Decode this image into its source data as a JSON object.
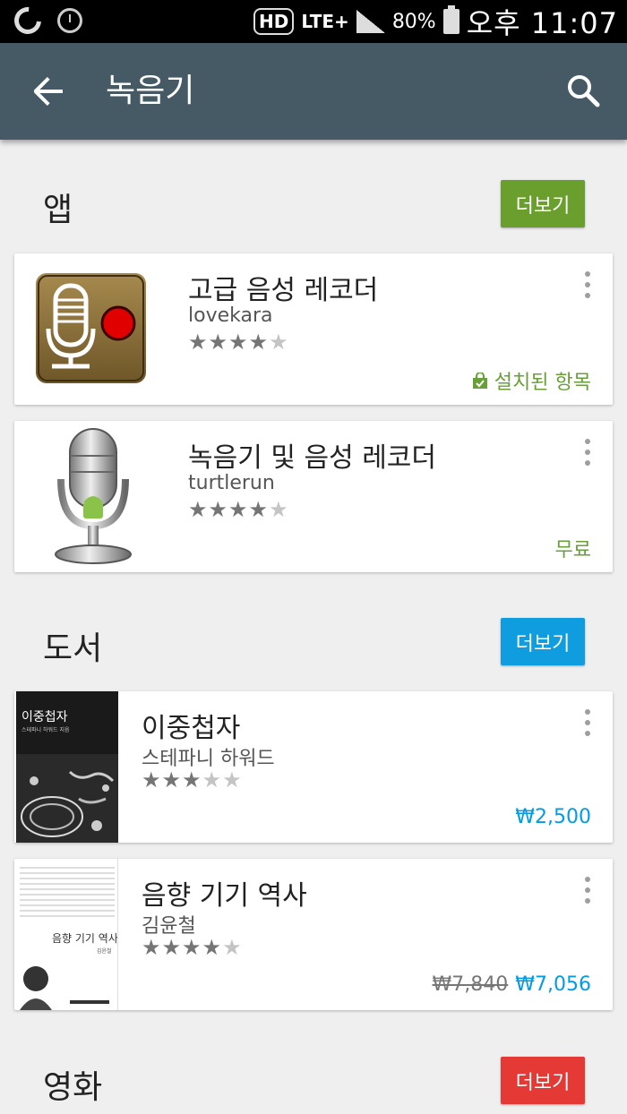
{
  "status_bar": {
    "hd": "HD",
    "lte": "LTE+",
    "battery": "80%",
    "time": "오후 11:07"
  },
  "toolbar": {
    "title": "녹음기"
  },
  "sections": [
    {
      "title": "앱",
      "more_label": "더보기",
      "more_color": "#6a9f2e",
      "items": [
        {
          "title": "고급 음성 레코더",
          "author": "lovekara",
          "rating": 4.5,
          "status": "설치된 항목",
          "icon": "voice-recorder-icon"
        },
        {
          "title": "녹음기 및 음성 레코더",
          "author": "turtlerun",
          "rating": 4.5,
          "price": "무료",
          "icon": "android-mic-icon"
        }
      ]
    },
    {
      "title": "도서",
      "more_label": "더보기",
      "more_color": "#0f9de0",
      "items": [
        {
          "title": "이중첩자",
          "author": "스테파니 하워드",
          "rating": 3.5,
          "price": "₩2,500",
          "cover_title": "이중첩자",
          "cover_subtitle": "스테파니 하워드 지음"
        },
        {
          "title": "음향 기기 역사",
          "author": "김윤철",
          "rating": 4.5,
          "original_price": "₩7,840",
          "price": "₩7,056",
          "cover_title": "음향 기기 역사",
          "cover_author": "김윤철"
        }
      ]
    },
    {
      "title": "영화",
      "more_label": "더보기",
      "more_color": "#e53935"
    }
  ]
}
